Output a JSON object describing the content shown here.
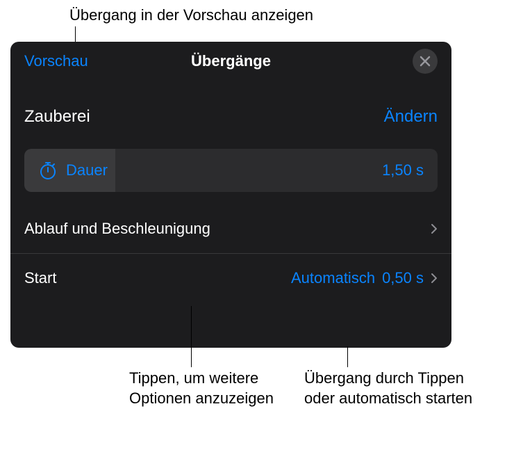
{
  "callouts": {
    "top": "Übergang in der Vorschau anzeigen",
    "bottom_left": "Tippen, um weitere Optionen anzuzeigen",
    "bottom_right": "Übergang durch Tippen oder automatisch starten"
  },
  "panel": {
    "preview": "Vorschau",
    "title": "Übergänge",
    "effect_name": "Zauberei",
    "change": "Ändern",
    "duration": {
      "label": "Dauer",
      "value": "1,50 s"
    },
    "row_delivery": "Ablauf und Beschleunigung",
    "row_start": {
      "label": "Start",
      "mode": "Automatisch",
      "time": "0,50 s"
    }
  }
}
